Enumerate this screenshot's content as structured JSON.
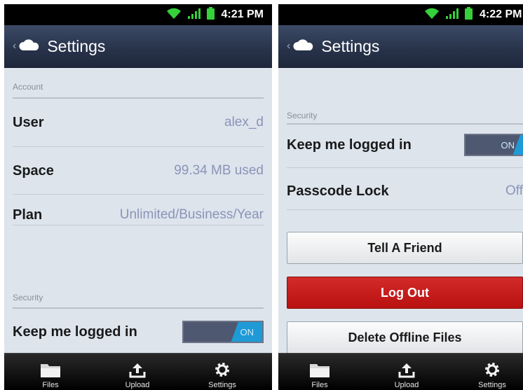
{
  "screens": [
    {
      "status": {
        "time": "4:21 PM"
      },
      "header": {
        "title": "Settings"
      },
      "account": {
        "section_label": "Account",
        "user": {
          "label": "User",
          "value": "alex_d"
        },
        "space": {
          "label": "Space",
          "value": "99.34 MB used"
        },
        "plan": {
          "label": "Plan",
          "value": "Unlimited/Business/Year"
        }
      },
      "security": {
        "section_label": "Security",
        "keep_logged_in": {
          "label": "Keep me logged in",
          "toggle": "ON"
        }
      },
      "tabs": [
        "Files",
        "Upload",
        "Settings"
      ]
    },
    {
      "status": {
        "time": "4:22 PM"
      },
      "header": {
        "title": "Settings"
      },
      "security": {
        "section_label": "Security",
        "keep_logged_in": {
          "label": "Keep me logged in",
          "toggle": "ON"
        },
        "passcode": {
          "label": "Passcode Lock",
          "value": "Off"
        }
      },
      "buttons": {
        "tell_friend": "Tell A Friend",
        "logout": "Log Out",
        "delete_offline": "Delete Offline Files"
      },
      "tabs": [
        "Files",
        "Upload",
        "Settings"
      ]
    }
  ],
  "colors": {
    "header": "#273249",
    "toggle_on": "#1e9ad6",
    "logout": "#c41a1a",
    "value_text": "#8a94b8"
  },
  "icons": [
    "wifi-icon",
    "signal-icon",
    "battery-icon",
    "back-chevron-icon",
    "cloud-icon",
    "folder-icon",
    "upload-icon",
    "gear-icon"
  ]
}
